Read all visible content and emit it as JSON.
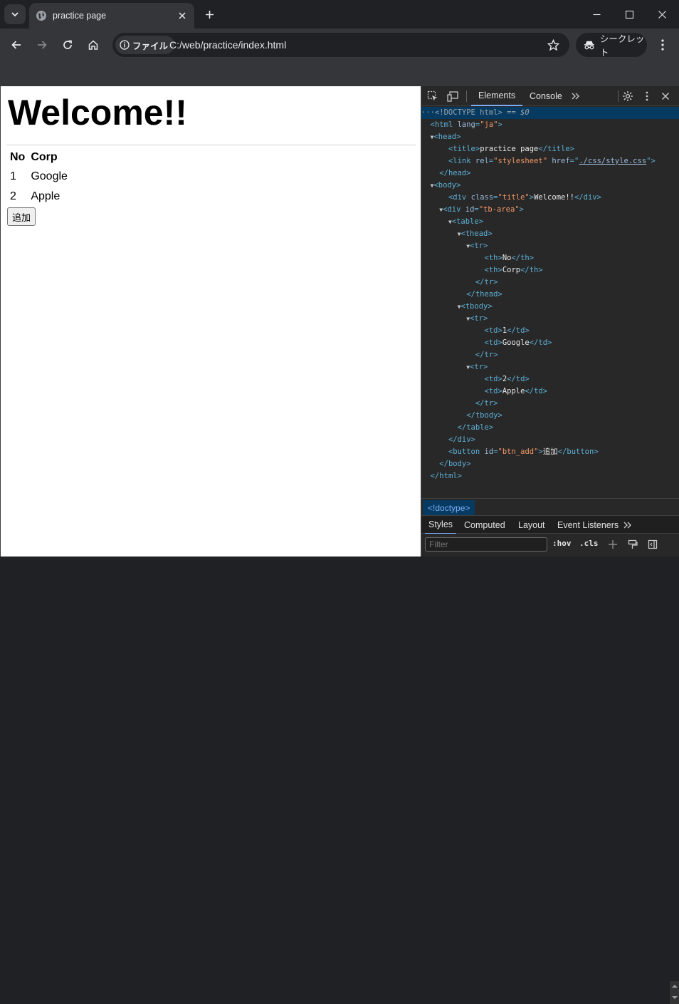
{
  "browser": {
    "tab_title": "practice page",
    "address_chip": "ファイル",
    "url": "C:/web/practice/index.html",
    "incognito_label": "シークレット"
  },
  "page": {
    "heading": "Welcome!!",
    "table": {
      "headers": [
        "No",
        "Corp"
      ],
      "rows": [
        [
          "1",
          "Google"
        ],
        [
          "2",
          "Apple"
        ]
      ]
    },
    "add_button": "追加"
  },
  "devtools": {
    "tabs": [
      "Elements",
      "Console"
    ],
    "active_tab": "Elements",
    "dom": {
      "doctype": "<!DOCTYPE html>",
      "selected_marker": " == $0",
      "html_open": "<html",
      "attr_lang": "lang",
      "val_lang": "\"ja\"",
      "gt": ">",
      "head_open": "<head>",
      "title_open": "<title>",
      "title_text": "practice page",
      "title_close": "</title>",
      "link_open": "<link",
      "attr_rel": "rel",
      "val_rel": "\"stylesheet\"",
      "attr_href": "href",
      "val_href": "./css/style.css",
      "head_close": "</head>",
      "body_open": "<body>",
      "div_open": "<div",
      "attr_class": "class",
      "val_title": "\"title\"",
      "div_title_text": "Welcome!!",
      "div_close": "</div>",
      "attr_id": "id",
      "val_tb_area": "\"tb-area\"",
      "table_open": "<table>",
      "thead_open": "<thead>",
      "tr_open": "<tr>",
      "th_open": "<th>",
      "th_close": "</th>",
      "th_no": "No",
      "th_corp": "Corp",
      "tr_close": "</tr>",
      "thead_close": "</thead>",
      "tbody_open": "<tbody>",
      "td_open": "<td>",
      "td_close": "</td>",
      "td_1": "1",
      "td_google": "Google",
      "td_2": "2",
      "td_apple": "Apple",
      "tbody_close": "</tbody>",
      "table_close": "</table>",
      "button_open": "<button",
      "val_btn_add": "\"btn_add\"",
      "button_text": "追加",
      "button_close": "</button>",
      "body_close": "</body>",
      "html_close": "</html>"
    },
    "breadcrumb": "<!doctype>",
    "sub_tabs": [
      "Styles",
      "Computed",
      "Layout",
      "Event Listeners"
    ],
    "filter_placeholder": "Filter",
    "hov_label": ":hov",
    "cls_label": ".cls"
  }
}
